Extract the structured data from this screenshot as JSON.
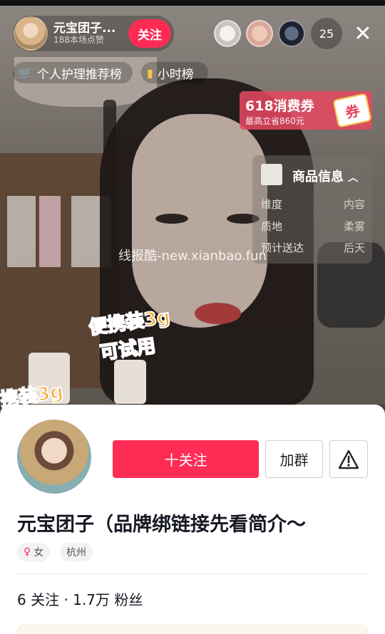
{
  "host": {
    "name": "元宝团子...",
    "subtitle": "188本场点赞",
    "follow_label": "关注"
  },
  "viewers": {
    "count": "25"
  },
  "rank_pills": [
    {
      "icon": "cart-icon",
      "label": "个人护理推荐榜"
    },
    {
      "icon": "bar-chart-icon",
      "label": "小时榜"
    }
  ],
  "coupon": {
    "title": "618消费券",
    "subtitle": "最高立省860元",
    "badge": "券"
  },
  "product_info": {
    "title": "商品信息",
    "rows": [
      {
        "key": "维度",
        "value": "内容"
      },
      {
        "key": "质地",
        "value": "柔雾"
      },
      {
        "key": "预计送达",
        "value": "后天"
      }
    ]
  },
  "stickers": {
    "a": "便携装3g",
    "b": "可试用",
    "c": "携装3g"
  },
  "watermark": "线报酷-new.xianbao.fun",
  "profile": {
    "follow_label": "十关注",
    "join_group_label": "加群",
    "name": "元宝团子（品牌绑链接先看简介～",
    "gender": "女",
    "city": "杭州",
    "stats": "6 关注 · 1.7万 粉丝"
  },
  "colors": {
    "accent": "#fe2c55",
    "coupon": "#e84860"
  }
}
